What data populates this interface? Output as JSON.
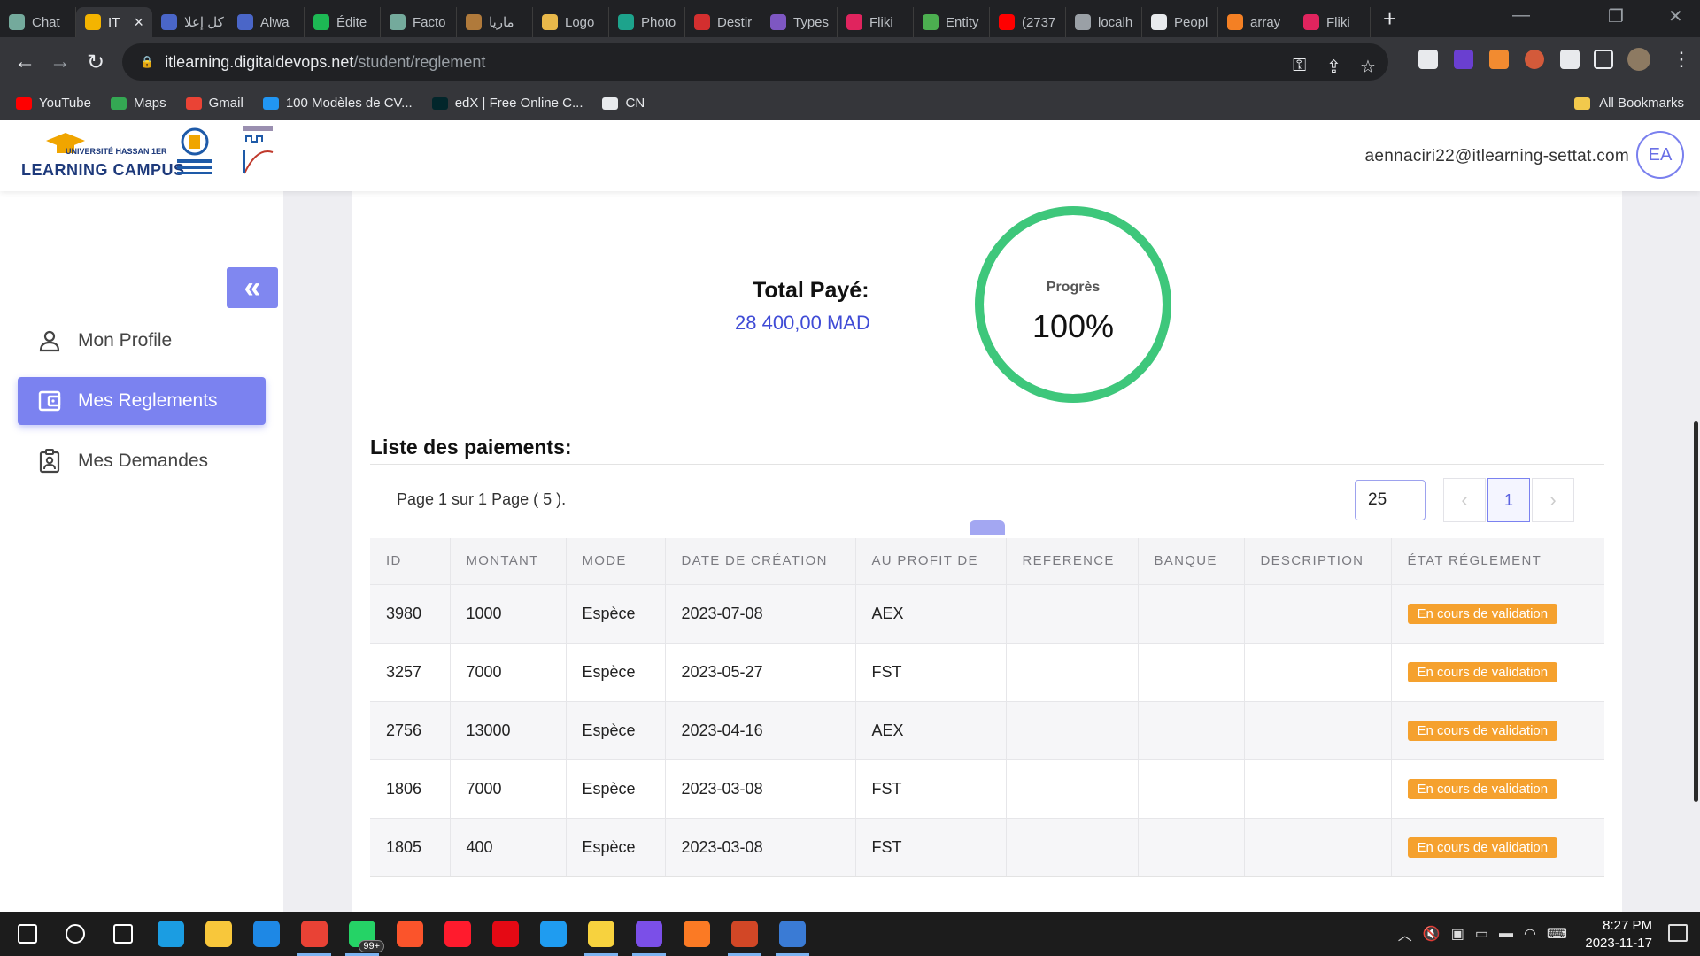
{
  "browser": {
    "tabs": [
      {
        "title": "Chat",
        "color": "#74aa9c"
      },
      {
        "title": "IT",
        "color": "#f4b400",
        "active": true
      },
      {
        "title": "كل إعلا",
        "color": "#4a66c8"
      },
      {
        "title": "Alwa",
        "color": "#4a66c8"
      },
      {
        "title": "Édite",
        "color": "#1db954"
      },
      {
        "title": "Facto",
        "color": "#74aa9c"
      },
      {
        "title": "ماريا",
        "color": "#b07a3b"
      },
      {
        "title": "Logo",
        "color": "#e8b84a"
      },
      {
        "title": "Photo",
        "color": "#1da38c"
      },
      {
        "title": "Destir",
        "color": "#d32f2f"
      },
      {
        "title": "Types",
        "color": "#7e57c2"
      },
      {
        "title": "Fliki",
        "color": "#e0245e"
      },
      {
        "title": "Entity",
        "color": "#4caf50"
      },
      {
        "title": "(2737",
        "color": "#ff0000"
      },
      {
        "title": "localh",
        "color": "#9aa0a6"
      },
      {
        "title": "Peopl",
        "color": "#e8eaed"
      },
      {
        "title": "array",
        "color": "#f48024"
      },
      {
        "title": "Fliki",
        "color": "#e0245e"
      }
    ],
    "tab_close": "×",
    "new_tab": "+",
    "url_host": "itlearning.digitaldevops.net",
    "url_path": "/student/reglement",
    "bookmarks": [
      {
        "label": "YouTube",
        "color": "#ff0000"
      },
      {
        "label": "Maps",
        "color": "#34a853"
      },
      {
        "label": "Gmail",
        "color": "#ea4335"
      },
      {
        "label": "100 Modèles de CV...",
        "color": "#2196f3"
      },
      {
        "label": "edX | Free Online C...",
        "color": "#02262b"
      },
      {
        "label": "CN",
        "color": "#e8eaed"
      }
    ],
    "all_bookmarks": "All Bookmarks"
  },
  "header": {
    "logo_university": "UNIVERSITÉ HASSAN 1ER",
    "logo_title": "LEARNING CAMPUS",
    "user_email": "aennaciri22@itlearning-settat.com",
    "avatar_initials": "EA"
  },
  "sidebar": {
    "collapse_icon": "«",
    "items": [
      {
        "label": "Mon Profile",
        "icon": "person-icon"
      },
      {
        "label": "Mes Reglements",
        "icon": "wallet-icon",
        "active": true
      },
      {
        "label": "Mes Demandes",
        "icon": "badge-icon"
      }
    ]
  },
  "summary": {
    "total_label": "Total Payé:",
    "total_value": "28 400,00 MAD",
    "progress_label": "Progrès",
    "progress_value": "100%",
    "progress_fraction": 1.0,
    "ring_color": "#3ec77b"
  },
  "payments": {
    "title": "Liste des paiements:",
    "page_info": "Page 1 sur 1 Page ( 5 ).",
    "per_page": "25",
    "current_page": "1",
    "prev_icon": "‹",
    "next_icon": "›",
    "columns": [
      "ID",
      "MONTANT",
      "MODE",
      "DATE DE CRÉATION",
      "AU PROFIT DE",
      "REFERENCE",
      "BANQUE",
      "DESCRIPTION",
      "ÉTAT RÉGLEMENT"
    ],
    "rows": [
      {
        "id": "3980",
        "montant": "1000",
        "mode": "Espèce",
        "date": "2023-07-08",
        "profit": "AEX",
        "reference": "",
        "banque": "",
        "description": "",
        "etat": "En cours de validation"
      },
      {
        "id": "3257",
        "montant": "7000",
        "mode": "Espèce",
        "date": "2023-05-27",
        "profit": "FST",
        "reference": "",
        "banque": "",
        "description": "",
        "etat": "En cours de validation"
      },
      {
        "id": "2756",
        "montant": "13000",
        "mode": "Espèce",
        "date": "2023-04-16",
        "profit": "AEX",
        "reference": "",
        "banque": "",
        "description": "",
        "etat": "En cours de validation"
      },
      {
        "id": "1806",
        "montant": "7000",
        "mode": "Espèce",
        "date": "2023-03-08",
        "profit": "FST",
        "reference": "",
        "banque": "",
        "description": "",
        "etat": "En cours de validation"
      },
      {
        "id": "1805",
        "montant": "400",
        "mode": "Espèce",
        "date": "2023-03-08",
        "profit": "FST",
        "reference": "",
        "banque": "",
        "description": "",
        "etat": "En cours de validation"
      }
    ]
  },
  "taskbar": {
    "apps": [
      {
        "name": "start-icon",
        "color": "#ffffff"
      },
      {
        "name": "search-icon",
        "color": "#ffffff"
      },
      {
        "name": "task-view-icon",
        "color": "#ffffff"
      },
      {
        "name": "edge-icon",
        "color": "#1b9de2"
      },
      {
        "name": "file-explorer-icon",
        "color": "#f8c73b"
      },
      {
        "name": "mail-icon",
        "color": "#1e88e5"
      },
      {
        "name": "chrome-icon",
        "color": "#e94235",
        "open": true
      },
      {
        "name": "whatsapp-icon",
        "color": "#25d366",
        "open": true
      },
      {
        "name": "brave-icon",
        "color": "#fb542b"
      },
      {
        "name": "opera-icon",
        "color": "#ff1b2d"
      },
      {
        "name": "netflix-icon",
        "color": "#e50914"
      },
      {
        "name": "vscode-icon",
        "color": "#1f9cf0"
      },
      {
        "name": "sticky-notes-icon",
        "color": "#f7d23e",
        "open": true
      },
      {
        "name": "intellij-icon",
        "color": "#7b4fe8",
        "open": true
      },
      {
        "name": "xampp-icon",
        "color": "#fb7a24"
      },
      {
        "name": "powerpoint-icon",
        "color": "#d24726",
        "open": true
      },
      {
        "name": "snipping-tool-icon",
        "color": "#3a7bd5",
        "open": true
      }
    ],
    "whatsapp_badge": "99+",
    "time": "8:27 PM",
    "date": "2023-11-17"
  }
}
